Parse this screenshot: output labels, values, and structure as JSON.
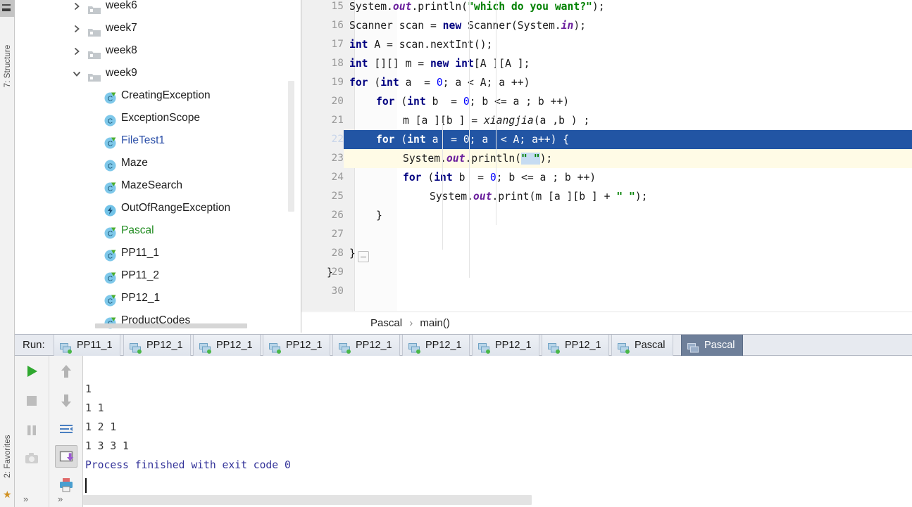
{
  "left_strip": {
    "structure_tab": "7: Structure",
    "favorites_tab": "2: Favorites"
  },
  "project_tree": {
    "items": [
      {
        "label": "week6",
        "kind": "folder",
        "expanded": false,
        "indent": 0,
        "color": "default"
      },
      {
        "label": "week7",
        "kind": "folder",
        "expanded": false,
        "indent": 0,
        "color": "default"
      },
      {
        "label": "week8",
        "kind": "folder",
        "expanded": false,
        "indent": 0,
        "color": "default"
      },
      {
        "label": "week9",
        "kind": "folder",
        "expanded": true,
        "indent": 0,
        "color": "default"
      },
      {
        "label": "CreatingException",
        "kind": "class-runnable",
        "indent": 1,
        "color": "default"
      },
      {
        "label": "ExceptionScope",
        "kind": "class",
        "indent": 1,
        "color": "default"
      },
      {
        "label": "FileTest1",
        "kind": "class-runnable",
        "indent": 1,
        "color": "blue"
      },
      {
        "label": "Maze",
        "kind": "class",
        "indent": 1,
        "color": "default"
      },
      {
        "label": "MazeSearch",
        "kind": "class-runnable",
        "indent": 1,
        "color": "default"
      },
      {
        "label": "OutOfRangeException",
        "kind": "exception",
        "indent": 1,
        "color": "default"
      },
      {
        "label": "Pascal",
        "kind": "class-runnable",
        "indent": 1,
        "color": "green"
      },
      {
        "label": "PP11_1",
        "kind": "class-runnable",
        "indent": 1,
        "color": "default"
      },
      {
        "label": "PP11_2",
        "kind": "class-runnable",
        "indent": 1,
        "color": "default"
      },
      {
        "label": "PP12_1",
        "kind": "class-runnable",
        "indent": 1,
        "color": "default"
      },
      {
        "label": "ProductCodes",
        "kind": "class-runnable",
        "indent": 1,
        "color": "default"
      }
    ]
  },
  "editor": {
    "first_line_number": 15,
    "selected_line": 22,
    "caret_line": 23,
    "lines": [
      {
        "n": 15,
        "indent": 0,
        "tokens": [
          {
            "t": "System.",
            "c": "plain"
          },
          {
            "t": "out",
            "c": "fld"
          },
          {
            "t": ".println(",
            "c": "plain"
          },
          {
            "t": "\"which do you want?\"",
            "c": "str"
          },
          {
            "t": ");",
            "c": "plain"
          }
        ]
      },
      {
        "n": 16,
        "indent": 0,
        "tokens": [
          {
            "t": "Scanner scan = ",
            "c": "plain"
          },
          {
            "t": "new",
            "c": "kw"
          },
          {
            "t": " Scanner(System.",
            "c": "plain"
          },
          {
            "t": "in",
            "c": "fld"
          },
          {
            "t": ");",
            "c": "plain"
          }
        ]
      },
      {
        "n": 17,
        "indent": 0,
        "tokens": [
          {
            "t": "int",
            "c": "kw"
          },
          {
            "t": " A = scan.nextInt();",
            "c": "plain"
          }
        ]
      },
      {
        "n": 18,
        "indent": 0,
        "tokens": [
          {
            "t": "int",
            "c": "kw"
          },
          {
            "t": " [][] m = ",
            "c": "plain"
          },
          {
            "t": "new",
            "c": "kw"
          },
          {
            "t": " ",
            "c": "plain"
          },
          {
            "t": "int",
            "c": "kw"
          },
          {
            "t": "[A ][A ];",
            "c": "plain"
          }
        ]
      },
      {
        "n": 19,
        "indent": 0,
        "tokens": [
          {
            "t": "for",
            "c": "kw"
          },
          {
            "t": " (",
            "c": "plain"
          },
          {
            "t": "int",
            "c": "kw"
          },
          {
            "t": " a  = ",
            "c": "plain"
          },
          {
            "t": "0",
            "c": "num"
          },
          {
            "t": "; a < A; a ++)",
            "c": "plain"
          }
        ]
      },
      {
        "n": 20,
        "indent": 1,
        "tokens": [
          {
            "t": "for",
            "c": "kw"
          },
          {
            "t": " (",
            "c": "plain"
          },
          {
            "t": "int",
            "c": "kw"
          },
          {
            "t": " b  = ",
            "c": "plain"
          },
          {
            "t": "0",
            "c": "num"
          },
          {
            "t": "; b <= a ; b ++)",
            "c": "plain"
          }
        ]
      },
      {
        "n": 21,
        "indent": 2,
        "tokens": [
          {
            "t": "m [a ][b ] = ",
            "c": "plain"
          },
          {
            "t": "xiangjia",
            "c": "ital"
          },
          {
            "t": "(a ,b ) ;",
            "c": "plain"
          }
        ]
      },
      {
        "n": 22,
        "indent": 1,
        "tokens": [
          {
            "t": "for",
            "c": "kw"
          },
          {
            "t": " (",
            "c": "plain"
          },
          {
            "t": "int",
            "c": "kw"
          },
          {
            "t": " a  = ",
            "c": "plain"
          },
          {
            "t": "0",
            "c": "num"
          },
          {
            "t": "; a  < A; a++) {",
            "c": "plain"
          }
        ]
      },
      {
        "n": 23,
        "indent": 2,
        "tokens": [
          {
            "t": "System.",
            "c": "plain"
          },
          {
            "t": "out",
            "c": "fld"
          },
          {
            "t": ".println(",
            "c": "plain"
          },
          {
            "t": "\" \"",
            "c": "str-hl"
          },
          {
            "t": ");",
            "c": "plain"
          }
        ]
      },
      {
        "n": 24,
        "indent": 2,
        "tokens": [
          {
            "t": "for",
            "c": "kw"
          },
          {
            "t": " (",
            "c": "plain"
          },
          {
            "t": "int",
            "c": "kw"
          },
          {
            "t": " b  = ",
            "c": "plain"
          },
          {
            "t": "0",
            "c": "num"
          },
          {
            "t": "; b <= a ; b ++)",
            "c": "plain"
          }
        ]
      },
      {
        "n": 25,
        "indent": 3,
        "tokens": [
          {
            "t": "System.",
            "c": "plain"
          },
          {
            "t": "out",
            "c": "fld"
          },
          {
            "t": ".print(m [a ][b ] + ",
            "c": "plain"
          },
          {
            "t": "\" \"",
            "c": "str"
          },
          {
            "t": ");",
            "c": "plain"
          }
        ]
      },
      {
        "n": 26,
        "indent": 1,
        "tokens": [
          {
            "t": "}",
            "c": "plain"
          }
        ]
      },
      {
        "n": 27,
        "indent": 0,
        "tokens": []
      },
      {
        "n": 28,
        "indent": 0,
        "tokens": [
          {
            "t": "}",
            "c": "plain"
          }
        ]
      },
      {
        "n": 29,
        "indent": -1,
        "tokens": [
          {
            "t": "}",
            "c": "plain"
          }
        ]
      },
      {
        "n": 30,
        "indent": 0,
        "tokens": []
      }
    ]
  },
  "breadcrumb": {
    "class": "Pascal",
    "separator": "›",
    "method": "main()"
  },
  "run_panel": {
    "run_label": "Run:",
    "tabs": [
      {
        "label": "PP11_1",
        "active": false
      },
      {
        "label": "PP12_1",
        "active": false
      },
      {
        "label": "PP12_1",
        "active": false
      },
      {
        "label": "PP12_1",
        "active": false
      },
      {
        "label": "PP12_1",
        "active": false
      },
      {
        "label": "PP12_1",
        "active": false
      },
      {
        "label": "PP12_1",
        "active": false
      },
      {
        "label": "PP12_1",
        "active": false
      },
      {
        "label": "Pascal",
        "active": false
      },
      {
        "label": "Pascal",
        "active": true
      }
    ],
    "toolbar_left": [
      {
        "icon": "rerun-play-icon",
        "state": "enabled"
      },
      {
        "icon": "stop-icon",
        "state": "disabled"
      },
      {
        "icon": "pause-icon",
        "state": "disabled"
      },
      {
        "icon": "camera-snapshot-icon",
        "state": "disabled"
      },
      {
        "icon": "expand-more-icon",
        "state": "enabled"
      }
    ],
    "toolbar_right": [
      {
        "icon": "arrow-up-icon",
        "state": "enabled"
      },
      {
        "icon": "arrow-down-icon",
        "state": "enabled"
      },
      {
        "icon": "soft-wrap-icon",
        "state": "enabled"
      },
      {
        "icon": "scroll-to-end-icon",
        "state": "selected"
      },
      {
        "icon": "print-icon",
        "state": "enabled"
      },
      {
        "icon": "expand-more-icon",
        "state": "enabled"
      }
    ],
    "console_output": [
      {
        "text": "1",
        "kind": "stdout"
      },
      {
        "text": "1 1",
        "kind": "stdout"
      },
      {
        "text": "1 2 1",
        "kind": "stdout"
      },
      {
        "text": "1 3 3 1",
        "kind": "stdout"
      },
      {
        "text": "Process finished with exit code 0",
        "kind": "system"
      }
    ]
  },
  "colors": {
    "selection_blue": "#2255a4",
    "caret_line_yellow": "#fffbe6",
    "keyword_navy": "#000080",
    "string_green": "#008000",
    "field_purple": "#6a1f9c",
    "run_tab_active": "#6e7f99",
    "console_system_blue": "#333399",
    "tree_green": "#1f8b1f",
    "tree_blue": "#2b4fa8"
  }
}
